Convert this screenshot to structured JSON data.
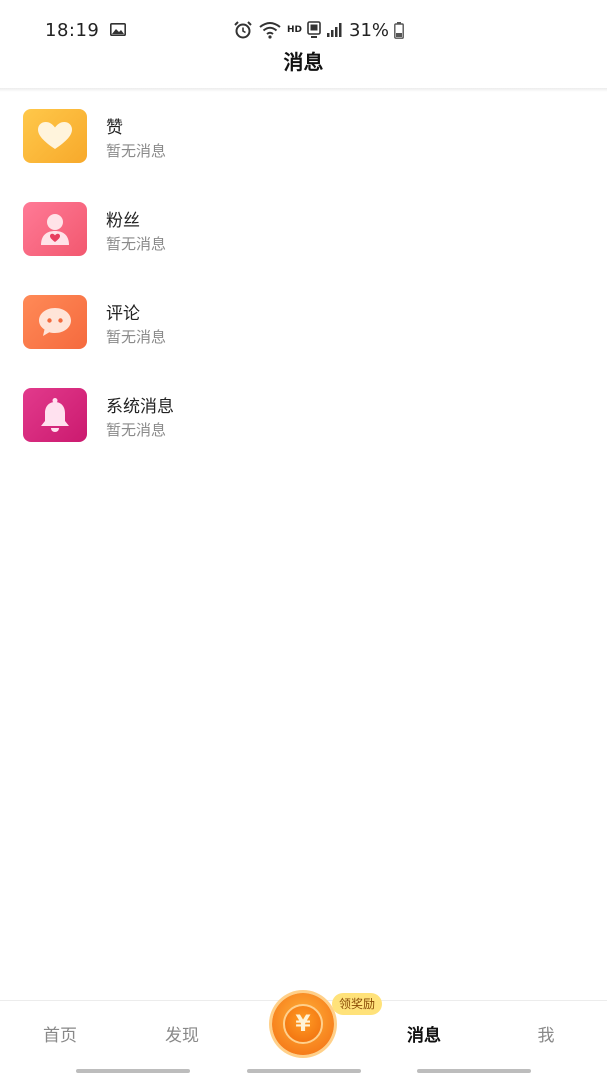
{
  "status_bar": {
    "time": "18:19",
    "hd": "HD",
    "battery_percent": "31%",
    "icons": [
      "gallery-icon",
      "alarm-icon",
      "wifi-icon",
      "sim-icon",
      "signal-icon",
      "battery-icon"
    ]
  },
  "header": {
    "title": "消息"
  },
  "messages": [
    {
      "title": "赞",
      "subtitle": "暂无消息",
      "icon": "heart-icon",
      "color": "#f9b43a"
    },
    {
      "title": "粉丝",
      "subtitle": "暂无消息",
      "icon": "user-icon",
      "color": "#f5677f"
    },
    {
      "title": "评论",
      "subtitle": "暂无消息",
      "icon": "comment-icon",
      "color": "#f77347"
    },
    {
      "title": "系统消息",
      "subtitle": "暂无消息",
      "icon": "bell-icon",
      "color": "#d62a7c"
    }
  ],
  "tabbar": {
    "tabs": [
      {
        "label": "首页",
        "active": false
      },
      {
        "label": "发现",
        "active": false
      },
      {
        "label": "消息",
        "active": true
      },
      {
        "label": "我",
        "active": false
      }
    ],
    "reward": {
      "badge": "领奖励",
      "symbol": "¥"
    }
  }
}
